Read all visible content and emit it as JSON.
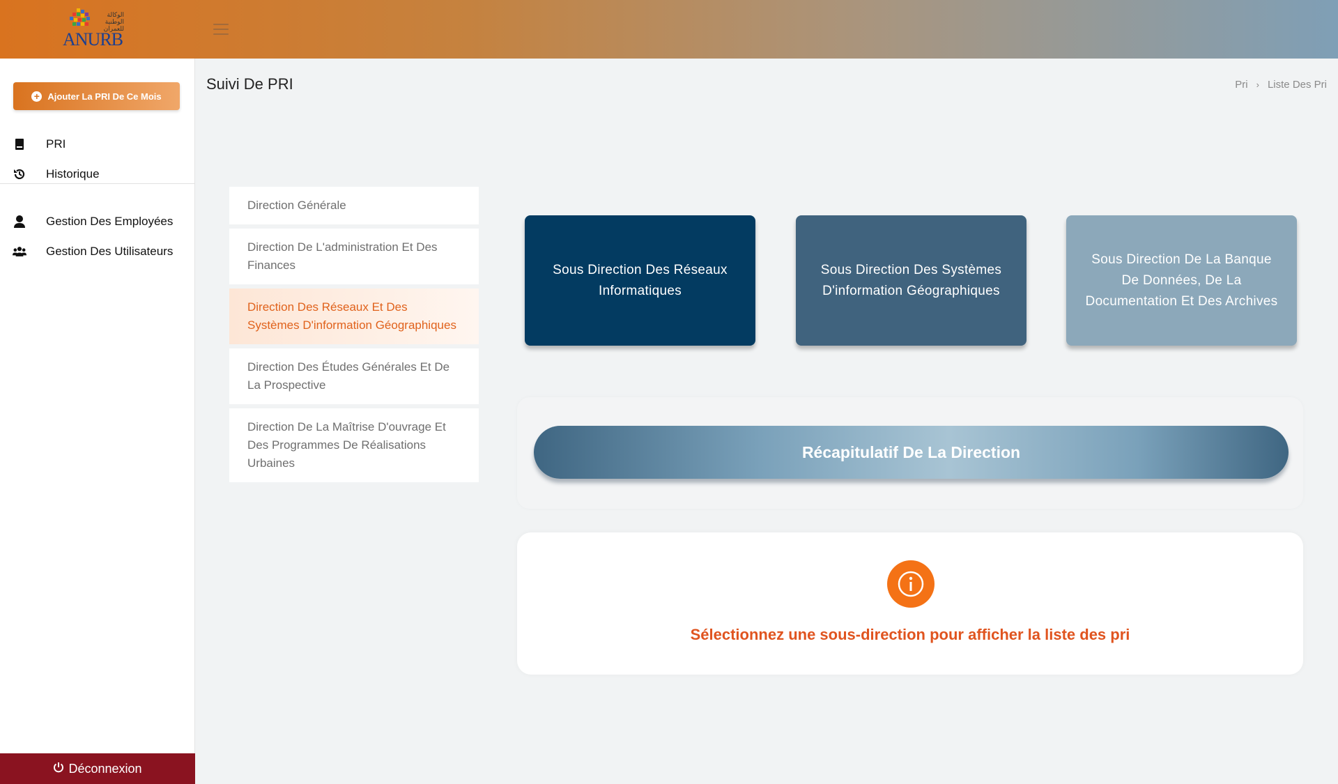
{
  "header": {
    "logo_text": "ANURB",
    "logo_arabic": "الوكالة الوطنية للعمران",
    "menu_icon": "hamburger-icon"
  },
  "sidebar": {
    "add_button_label": "Ajouter La PRI De Ce Mois",
    "items": [
      {
        "label": "PRI",
        "icon": "book-icon"
      },
      {
        "label": "Historique",
        "icon": "history-icon"
      },
      {
        "label": "Gestion Des Employées",
        "icon": "user-icon"
      },
      {
        "label": "Gestion Des Utilisateurs",
        "icon": "users-icon"
      }
    ],
    "logout_label": "Déconnexion"
  },
  "page": {
    "title": "Suivi De PRI",
    "breadcrumb": [
      "Pri",
      "Liste Des Pri"
    ]
  },
  "directions": [
    {
      "label": "Direction Générale",
      "active": false
    },
    {
      "label": "Direction De L'administration Et Des Finances",
      "active": false
    },
    {
      "label": "Direction Des Réseaux Et Des Systèmes D'information Géographiques",
      "active": true
    },
    {
      "label": "Direction Des Études Générales Et De La Prospective",
      "active": false
    },
    {
      "label": "Direction De La Maîtrise D'ouvrage Et Des Programmes De Réalisations Urbaines",
      "active": false
    }
  ],
  "sub_directions": [
    {
      "label": "Sous Direction Des Réseaux Informatiques",
      "color": "#033b61"
    },
    {
      "label": "Sous Direction Des Systèmes D'information Géographiques",
      "color": "#40637e"
    },
    {
      "label": "Sous Direction De La Banque De Données, De La Documentation Et Des Archives",
      "color": "#8ca8ba"
    }
  ],
  "recap_button_label": "Récapitulatif De La Direction",
  "info_message": "Sélectionnez une sous-direction pour afficher la liste des pri",
  "colors": {
    "accent_orange": "#f47216",
    "logout_red": "#8a1320"
  }
}
